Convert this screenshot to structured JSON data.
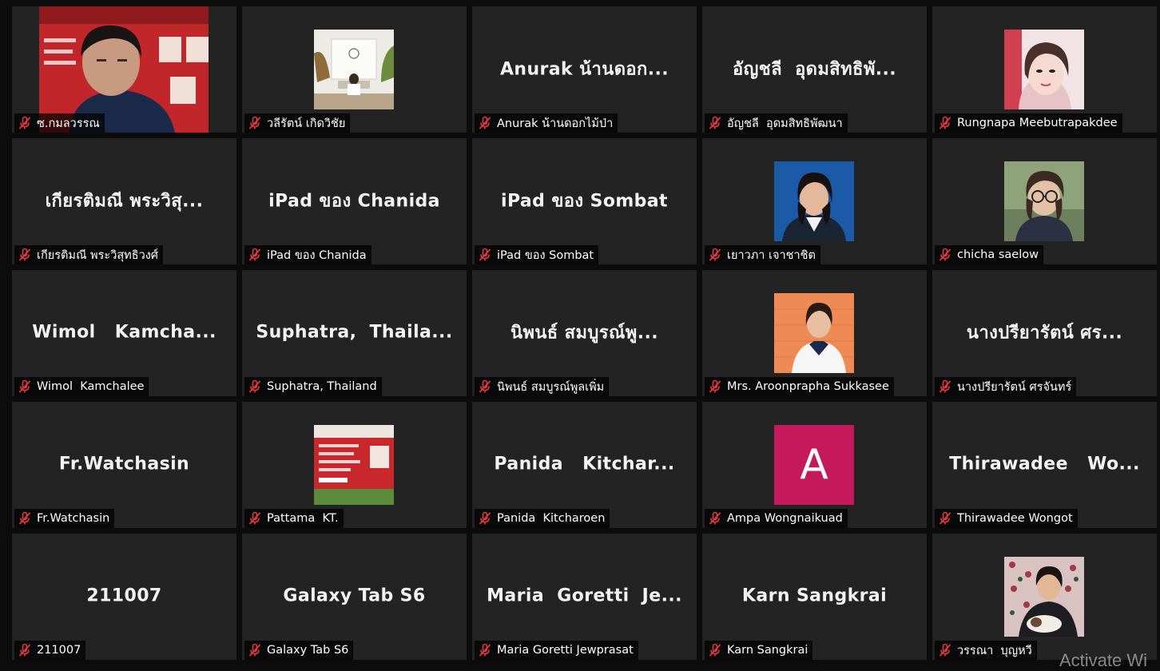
{
  "participants": [
    {
      "big": "",
      "name": "ซ.กมลวรรณ",
      "avatar": "video"
    },
    {
      "big": "",
      "name": "วลีรัตน์ เกิดวิชัย",
      "avatar": "photo-bench"
    },
    {
      "big": "Anurak น้านดอก...",
      "name": "Anurak น้านดอกไม้ป่า",
      "avatar": "none"
    },
    {
      "big": "อัญชลี  อุดมสิทธิพั...",
      "name": "อัญชลี  อุดมสิทธิพัฒนา",
      "avatar": "none"
    },
    {
      "big": "",
      "name": "Rungnapa Meebutrapakdee",
      "avatar": "photo-woman-pink"
    },
    {
      "big": "เกียรติมณี พระวิสุ...",
      "name": "เกียรติมณี พระวิสุทธิวงศ์",
      "avatar": "none"
    },
    {
      "big": "iPad ของ Chanida",
      "name": "iPad ของ Chanida",
      "avatar": "none"
    },
    {
      "big": "iPad ของ Sombat",
      "name": "iPad ของ Sombat",
      "avatar": "none"
    },
    {
      "big": "",
      "name": "เยาวภา เจาชาชิต",
      "avatar": "photo-woman-blue"
    },
    {
      "big": "",
      "name": "chicha saelow",
      "avatar": "photo-glasses"
    },
    {
      "big": "Wimol   Kamcha...",
      "name": "Wimol  Kamchalee",
      "avatar": "none"
    },
    {
      "big": "Suphatra,  Thaila...",
      "name": "Suphatra, Thailand",
      "avatar": "none"
    },
    {
      "big": "นิพนธ์ สมบูรณ์พู...",
      "name": "นิพนธ์ สมบูรณ์พูลเพิ่ม",
      "avatar": "none"
    },
    {
      "big": "",
      "name": "Mrs. Aroonprapha Sukkasee",
      "avatar": "photo-woman-orange"
    },
    {
      "big": "นางปรียารัตน์ ศร...",
      "name": "นางปรียารัตน์ ศรจันทร์",
      "avatar": "none"
    },
    {
      "big": "Fr.Watchasin",
      "name": "Fr.Watchasin",
      "avatar": "none"
    },
    {
      "big": "",
      "name": "Pattama  KT.",
      "avatar": "photo-poster"
    },
    {
      "big": "Panida   Kitchar...",
      "name": "Panida  Kitcharoen",
      "avatar": "none"
    },
    {
      "big": "",
      "name": "Ampa Wongnaikuad",
      "avatar": "letter",
      "letter": "A"
    },
    {
      "big": "Thirawadee   Wo...",
      "name": "Thirawadee Wongot",
      "avatar": "none"
    },
    {
      "big": "211007",
      "name": "211007",
      "avatar": "none"
    },
    {
      "big": "Galaxy Tab S6",
      "name": "Galaxy Tab S6",
      "avatar": "none"
    },
    {
      "big": "Maria  Goretti  Je...",
      "name": "Maria Goretti Jewprasat",
      "avatar": "none"
    },
    {
      "big": "Karn Sangkrai",
      "name": "Karn Sangkrai",
      "avatar": "none"
    },
    {
      "big": "",
      "name": "วรรณา  บุญหวี",
      "avatar": "photo-cat"
    }
  ],
  "watermark": "Activate Wi",
  "colors": {
    "tile": "#232323",
    "muted_mic": "#e0393e",
    "letter_avatar": "#c41a5c"
  }
}
